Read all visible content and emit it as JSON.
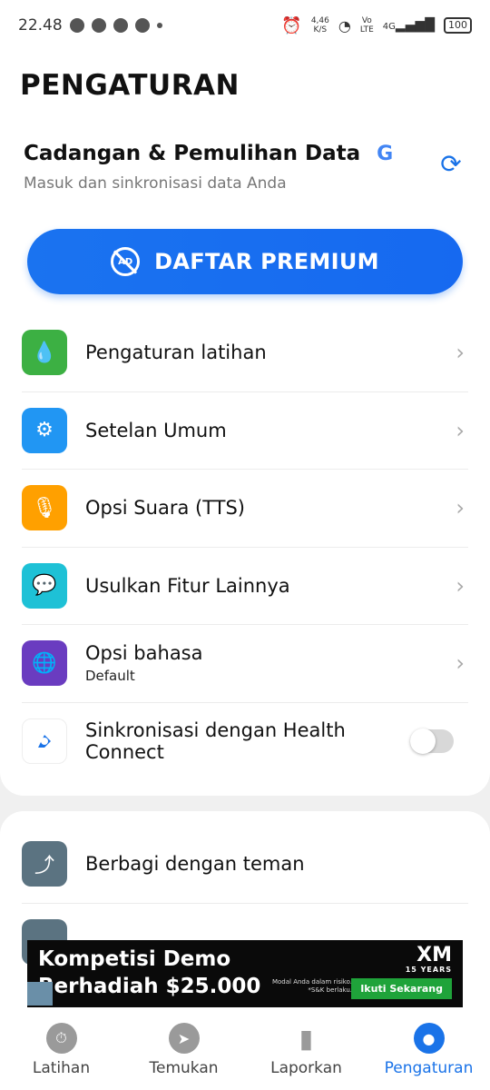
{
  "status_bar": {
    "time": "22.48",
    "net_speed": "4,46",
    "net_unit": "K/S",
    "volte_top": "Vo",
    "volte_bottom": "LTE",
    "signal": "4G",
    "battery": "100"
  },
  "page": {
    "title": "PENGATURAN"
  },
  "backup": {
    "title": "Cadangan & Pemulihan Data",
    "google_glyph": "G",
    "subtitle": "Masuk dan sinkronisasi data Anda"
  },
  "premium": {
    "label": "DAFTAR PREMIUM",
    "ad_glyph": "AD"
  },
  "menu": [
    {
      "label": "Pengaturan latihan",
      "color": "#3cb043"
    },
    {
      "label": "Setelan Umum",
      "color": "#2196f3"
    },
    {
      "label": "Opsi Suara (TTS)",
      "color": "#ffa000"
    },
    {
      "label": "Usulkan Fitur Lainnya",
      "color": "#1ec1d6"
    },
    {
      "label": "Opsi bahasa",
      "sub": "Default",
      "color": "#6a3cc0"
    },
    {
      "label": "Sinkronisasi dengan Health Connect",
      "color": "#ffffff",
      "toggle_on": false
    }
  ],
  "menu2": [
    {
      "label": "Berbagi dengan teman",
      "color": "#5b7381"
    }
  ],
  "ad": {
    "line1": "Kompetisi Demo",
    "line2": "Berhadiah $25.000",
    "logo": "XM",
    "logo_sub": "15 YEARS",
    "disclaimer1": "Modal Anda dalam risiko.",
    "disclaimer2": "*S&K berlaku.",
    "cta": "Ikuti Sekarang"
  },
  "bottom_nav": [
    {
      "label": "Latihan",
      "active": false
    },
    {
      "label": "Temukan",
      "active": false
    },
    {
      "label": "Laporkan",
      "active": false
    },
    {
      "label": "Pengaturan",
      "active": true
    }
  ]
}
